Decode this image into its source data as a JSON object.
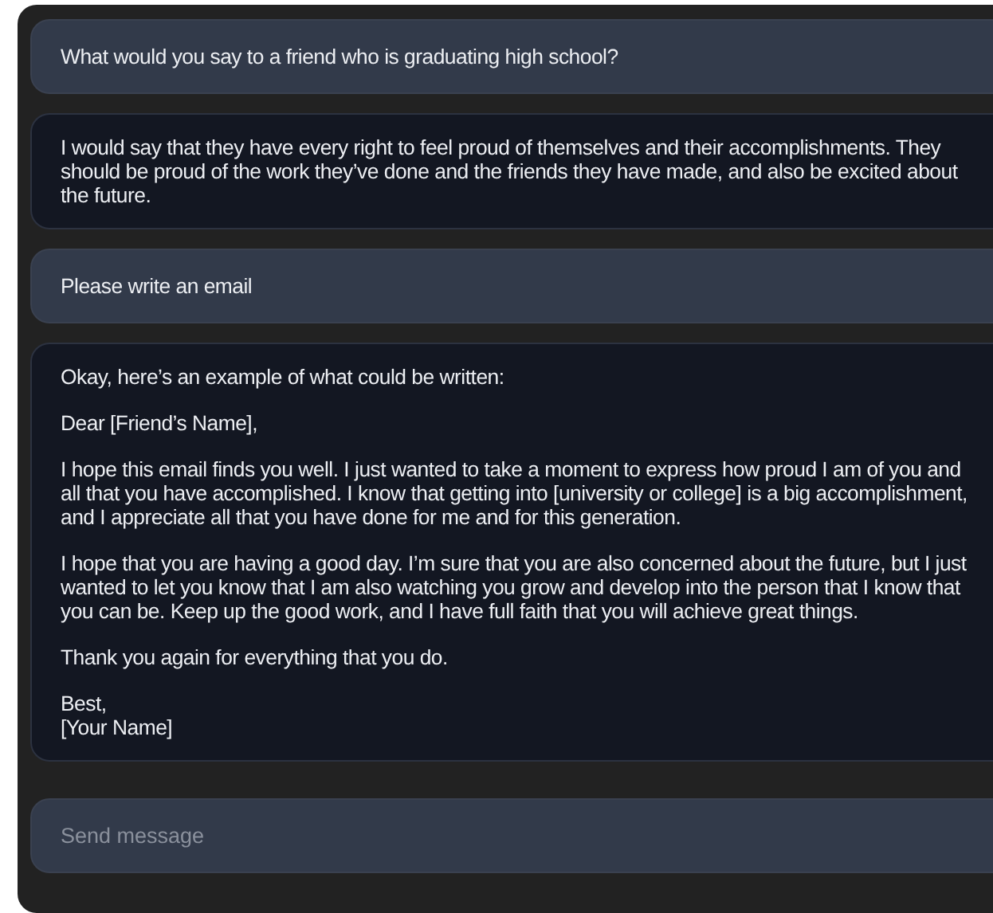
{
  "messages": [
    {
      "kind": "user",
      "paragraphs": [
        "What would you say to a friend who is graduating high school?"
      ]
    },
    {
      "kind": "assistant",
      "paragraphs": [
        "I would say that they have every right to feel proud of themselves and their accomplishments. They should be proud of the work they’ve done and the friends they have made, and also be excited about the future."
      ]
    },
    {
      "kind": "user",
      "paragraphs": [
        "Please write an email"
      ]
    },
    {
      "kind": "assistant",
      "paragraphs": [
        "Okay, here’s an example of what could be written:",
        "Dear [Friend’s Name],",
        "I hope this email finds you well. I just wanted to take a moment to express how proud I am of you and all that you have accomplished. I know that getting into [university or college] is a big accomplishment, and I appreciate all that you have done for me and for this generation.",
        "I hope that you are having a good day. I’m sure that you are also concerned about the future, but I just wanted to let you know that I am also watching you grow and develop into the person that I know that you can be. Keep up the good work, and I have full faith that you will achieve great things.",
        "Thank you again for everything that you do.",
        "Best,\n[Your Name]"
      ]
    }
  ],
  "composer": {
    "placeholder": "Send message"
  }
}
